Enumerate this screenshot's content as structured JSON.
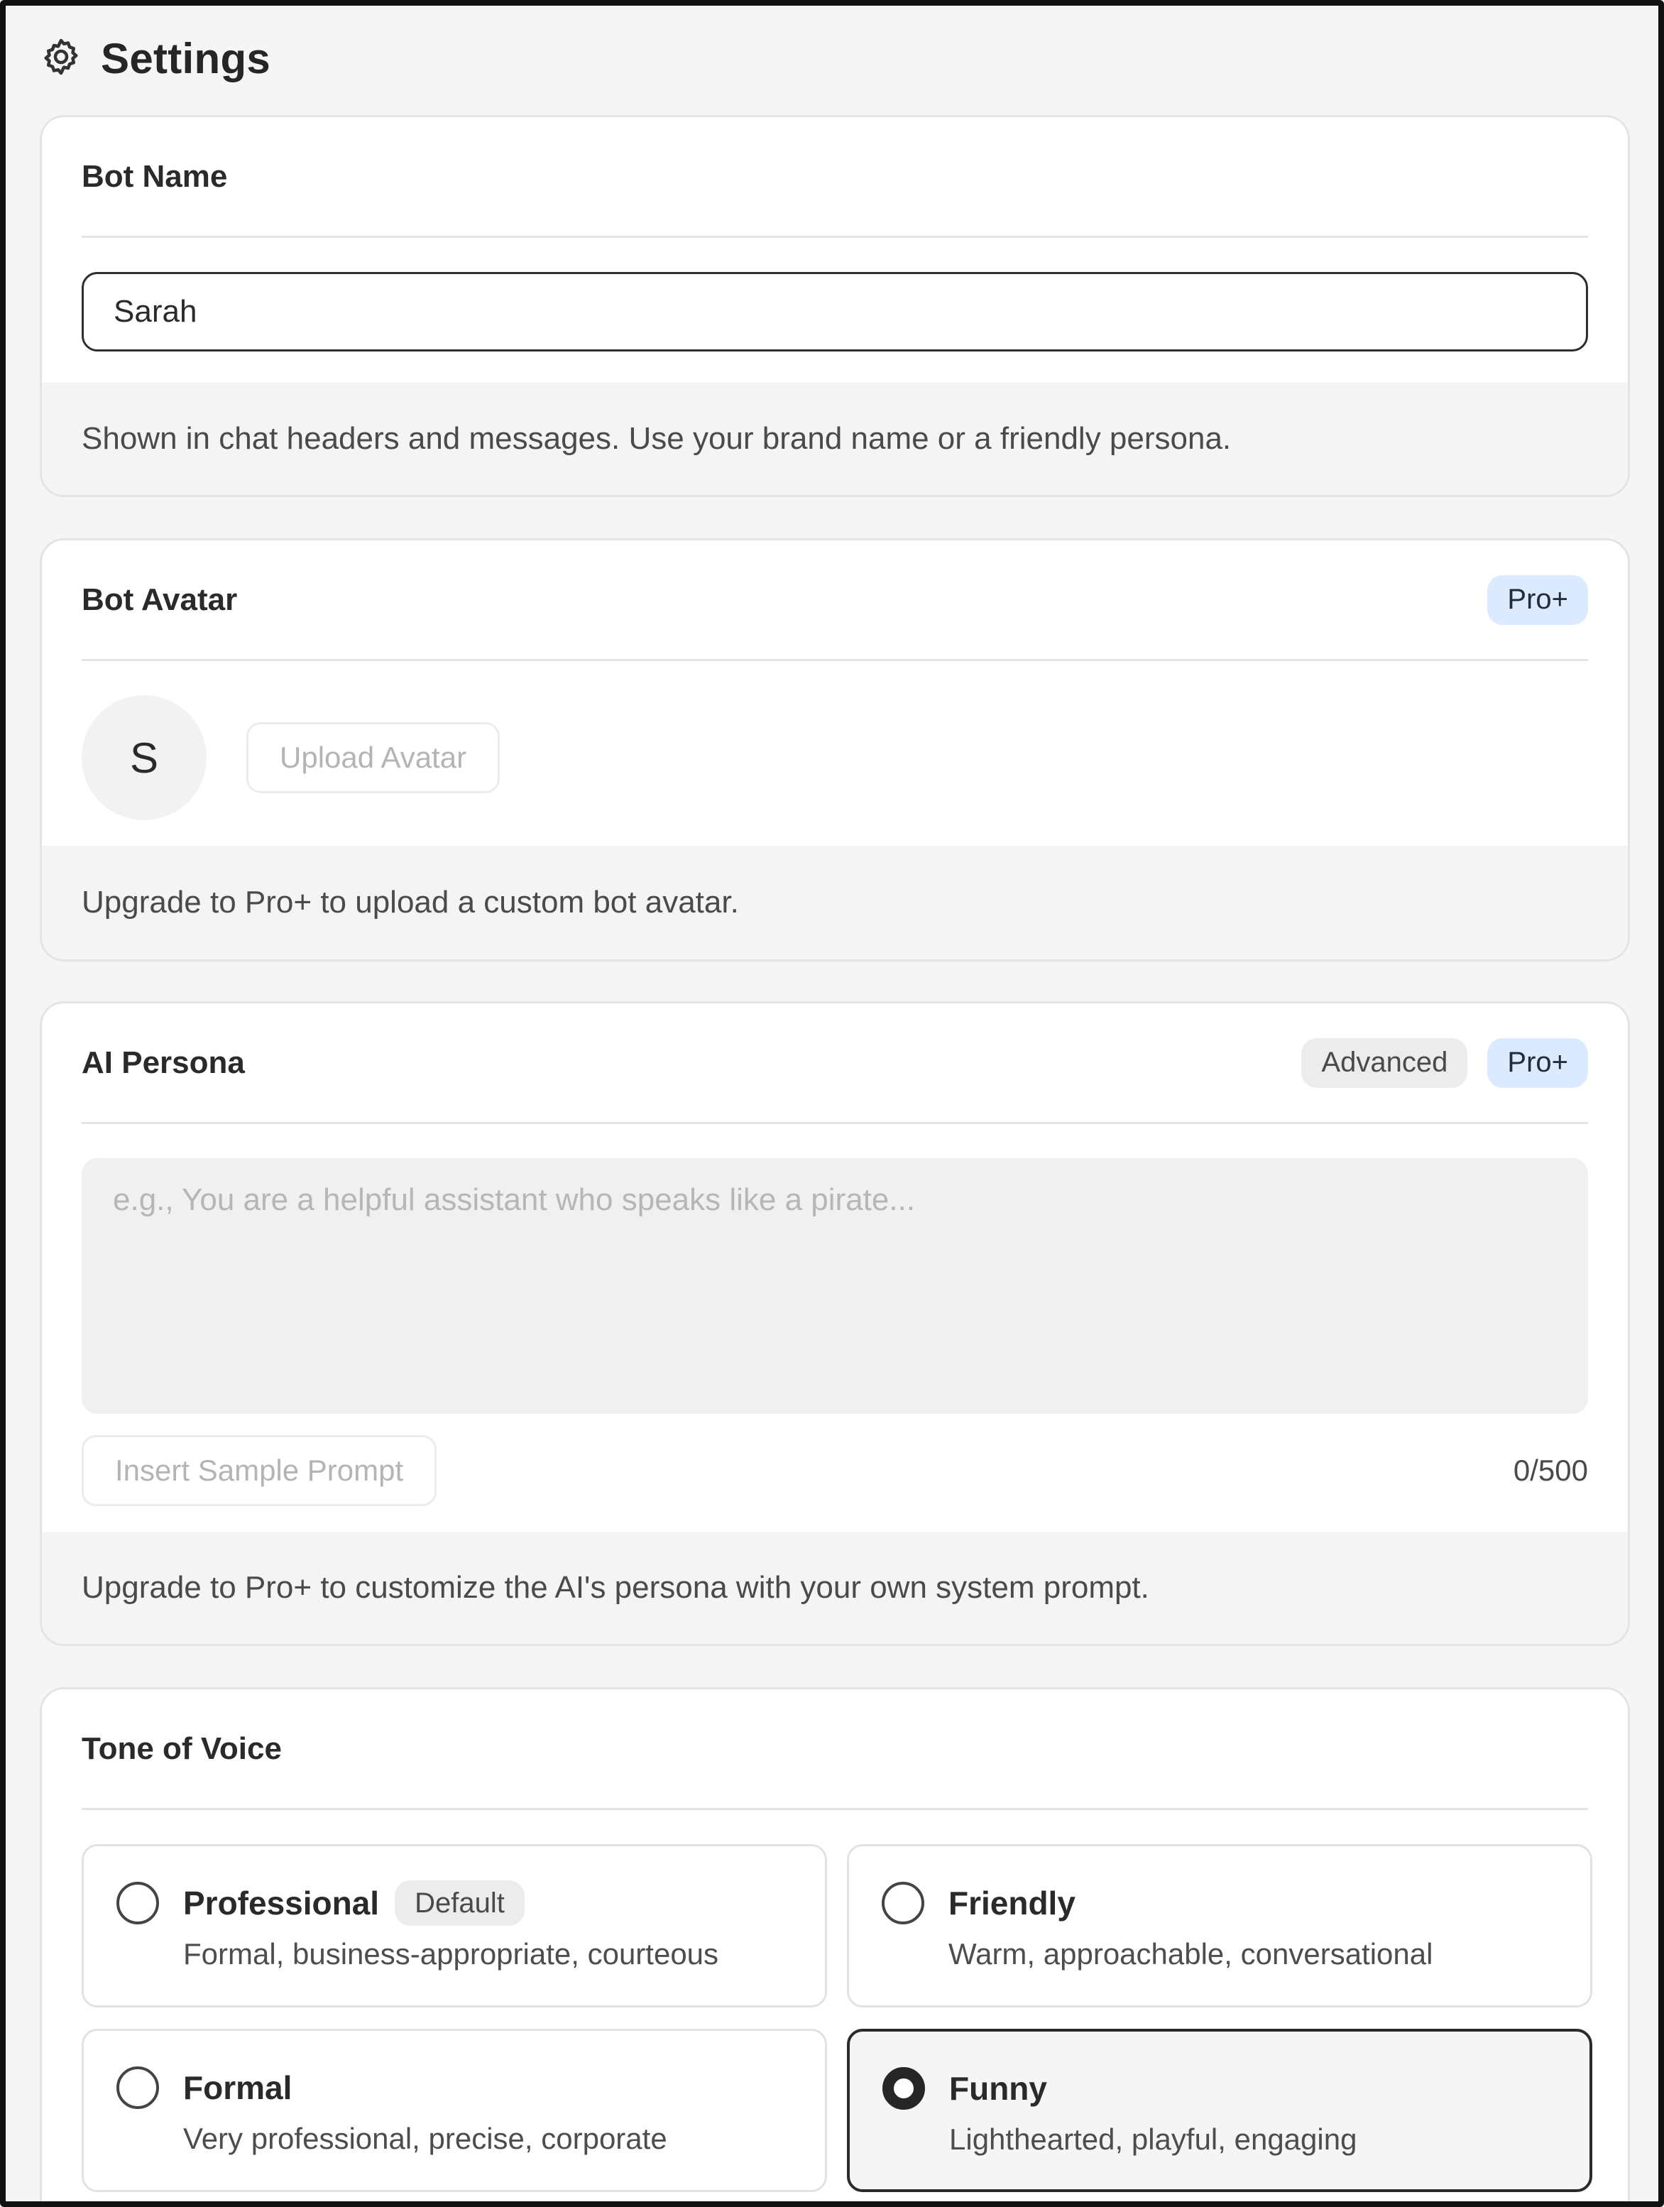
{
  "header": {
    "title": "Settings",
    "icon": "gear-icon"
  },
  "bot_name": {
    "title": "Bot Name",
    "value": "Sarah",
    "help": "Shown in chat headers and messages. Use your brand name or a friendly persona."
  },
  "bot_avatar": {
    "title": "Bot Avatar",
    "badge": "Pro+",
    "avatar_letter": "S",
    "upload_label": "Upload Avatar",
    "help": "Upgrade to Pro+ to upload a custom bot avatar."
  },
  "ai_persona": {
    "title": "AI Persona",
    "badges": [
      "Advanced",
      "Pro+"
    ],
    "placeholder": "e.g., You are a helpful assistant who speaks like a pirate...",
    "sample_label": "Insert Sample Prompt",
    "counter": "0/500",
    "help": "Upgrade to Pro+ to customize the AI's persona with your own system prompt."
  },
  "tone": {
    "title": "Tone of Voice",
    "options": [
      {
        "label": "Professional",
        "badge": "Default",
        "description": "Formal, business-appropriate, courteous",
        "selected": false
      },
      {
        "label": "Friendly",
        "description": "Warm, approachable, conversational",
        "selected": false
      },
      {
        "label": "Formal",
        "description": "Very professional, precise, corporate",
        "selected": false
      },
      {
        "label": "Funny",
        "description": "Lighthearted, playful, engaging",
        "selected": true
      }
    ]
  },
  "colors": {
    "pro_badge_bg": "#dbeafe",
    "border": "#e4e4e4",
    "selected_border": "#2a2a2a"
  }
}
